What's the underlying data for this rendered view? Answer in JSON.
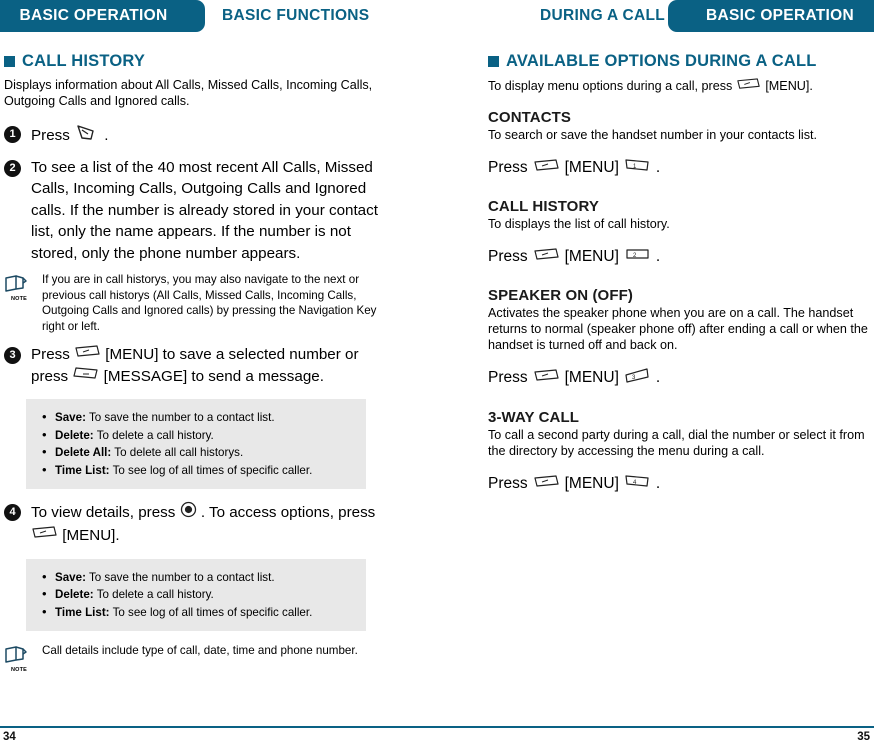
{
  "header": {
    "tab_left_active": "BASIC OPERATION",
    "tab_left_plain": "BASIC FUNCTIONS",
    "tab_right_plain": "DURING A CALL",
    "tab_right_active": "BASIC OPERATION",
    "accent_color": "#0a6184"
  },
  "left_page": {
    "section_title": "CALL HISTORY",
    "intro": "Displays information about All Calls, Missed Calls, Incoming Calls, Outgoing Calls and Ignored calls.",
    "steps": [
      {
        "num": "1",
        "text_before": "Press",
        "icon": "end-key-icon",
        "text_after": "."
      },
      {
        "num": "2",
        "text": "To see a list of the 40 most recent All Calls, Missed Calls, Incoming Calls, Outgoing Calls and Ignored calls. If the number is already stored in your contact list, only the name appears. If the number is not stored, only the phone number appears."
      },
      {
        "num": "3",
        "part1": "Press",
        "icon1": "menu-key-icon",
        "part2": "[MENU] to save a selected number or press",
        "icon2": "message-key-icon",
        "part3": "[MESSAGE] to send a message."
      },
      {
        "num": "4",
        "part1": "To view details, press",
        "icon1": "navigation-key-icon",
        "part2": ". To access options, press",
        "icon2": "menu-key-icon",
        "part3": "[MENU]."
      }
    ],
    "note_1": {
      "label": "NOTE",
      "text": "If you are in call historys, you may also navigate to the next or previous call historys (All Calls, Missed Calls, Incoming Calls, Outgoing Calls and Ignored calls) by pressing the Navigation Key right or left."
    },
    "note_2": {
      "label": "NOTE",
      "text": "Call details include type of call, date, time and phone number."
    },
    "options_box_1": [
      {
        "term": "Save:",
        "desc": "To save the number to a contact list."
      },
      {
        "term": "Delete:",
        "desc": "To delete a call history."
      },
      {
        "term": "Delete All:",
        "desc": "To delete all call historys."
      },
      {
        "term": "Time List:",
        "desc": "To see log of all times of specific caller."
      }
    ],
    "options_box_2": [
      {
        "term": "Save:",
        "desc": "To save the number to a contact list."
      },
      {
        "term": "Delete:",
        "desc": "To delete a call history."
      },
      {
        "term": "Time List:",
        "desc": "To see log of all times of specific caller."
      }
    ],
    "page_number": "34"
  },
  "right_page": {
    "section_title": "AVAILABLE OPTIONS DURING A CALL",
    "intro_before": "To display menu options during a call, press",
    "intro_icon": "menu-key-icon",
    "intro_after": "[MENU].",
    "sections": [
      {
        "heading": "CONTACTS",
        "body": "To search or save the handset number in your contacts list.",
        "press_label": "Press",
        "menu_icon": "menu-key-icon",
        "menu_label": "[MENU]",
        "key_icon": "key-1-icon",
        "key_digit": "1",
        "period": "."
      },
      {
        "heading": "CALL HISTORY",
        "body": "To displays the list of call history.",
        "press_label": "Press",
        "menu_icon": "menu-key-icon",
        "menu_label": "[MENU]",
        "key_icon": "key-2-icon",
        "key_digit": "2",
        "period": "."
      },
      {
        "heading": "SPEAKER ON (OFF)",
        "body": "Activates the speaker phone when you are on a call. The handset returns to normal (speaker phone off) after ending a call or when the handset is turned off and back on.",
        "press_label": "Press",
        "menu_icon": "menu-key-icon",
        "menu_label": "[MENU]",
        "key_icon": "key-3-icon",
        "key_digit": "3",
        "period": "."
      },
      {
        "heading": "3-WAY CALL",
        "body": "To call a second party during a call, dial the number or select it from the directory by accessing the menu during a call.",
        "press_label": "Press",
        "menu_icon": "menu-key-icon",
        "menu_label": "[MENU]",
        "key_icon": "key-4-icon",
        "key_digit": "4",
        "period": "."
      }
    ],
    "page_number": "35"
  }
}
